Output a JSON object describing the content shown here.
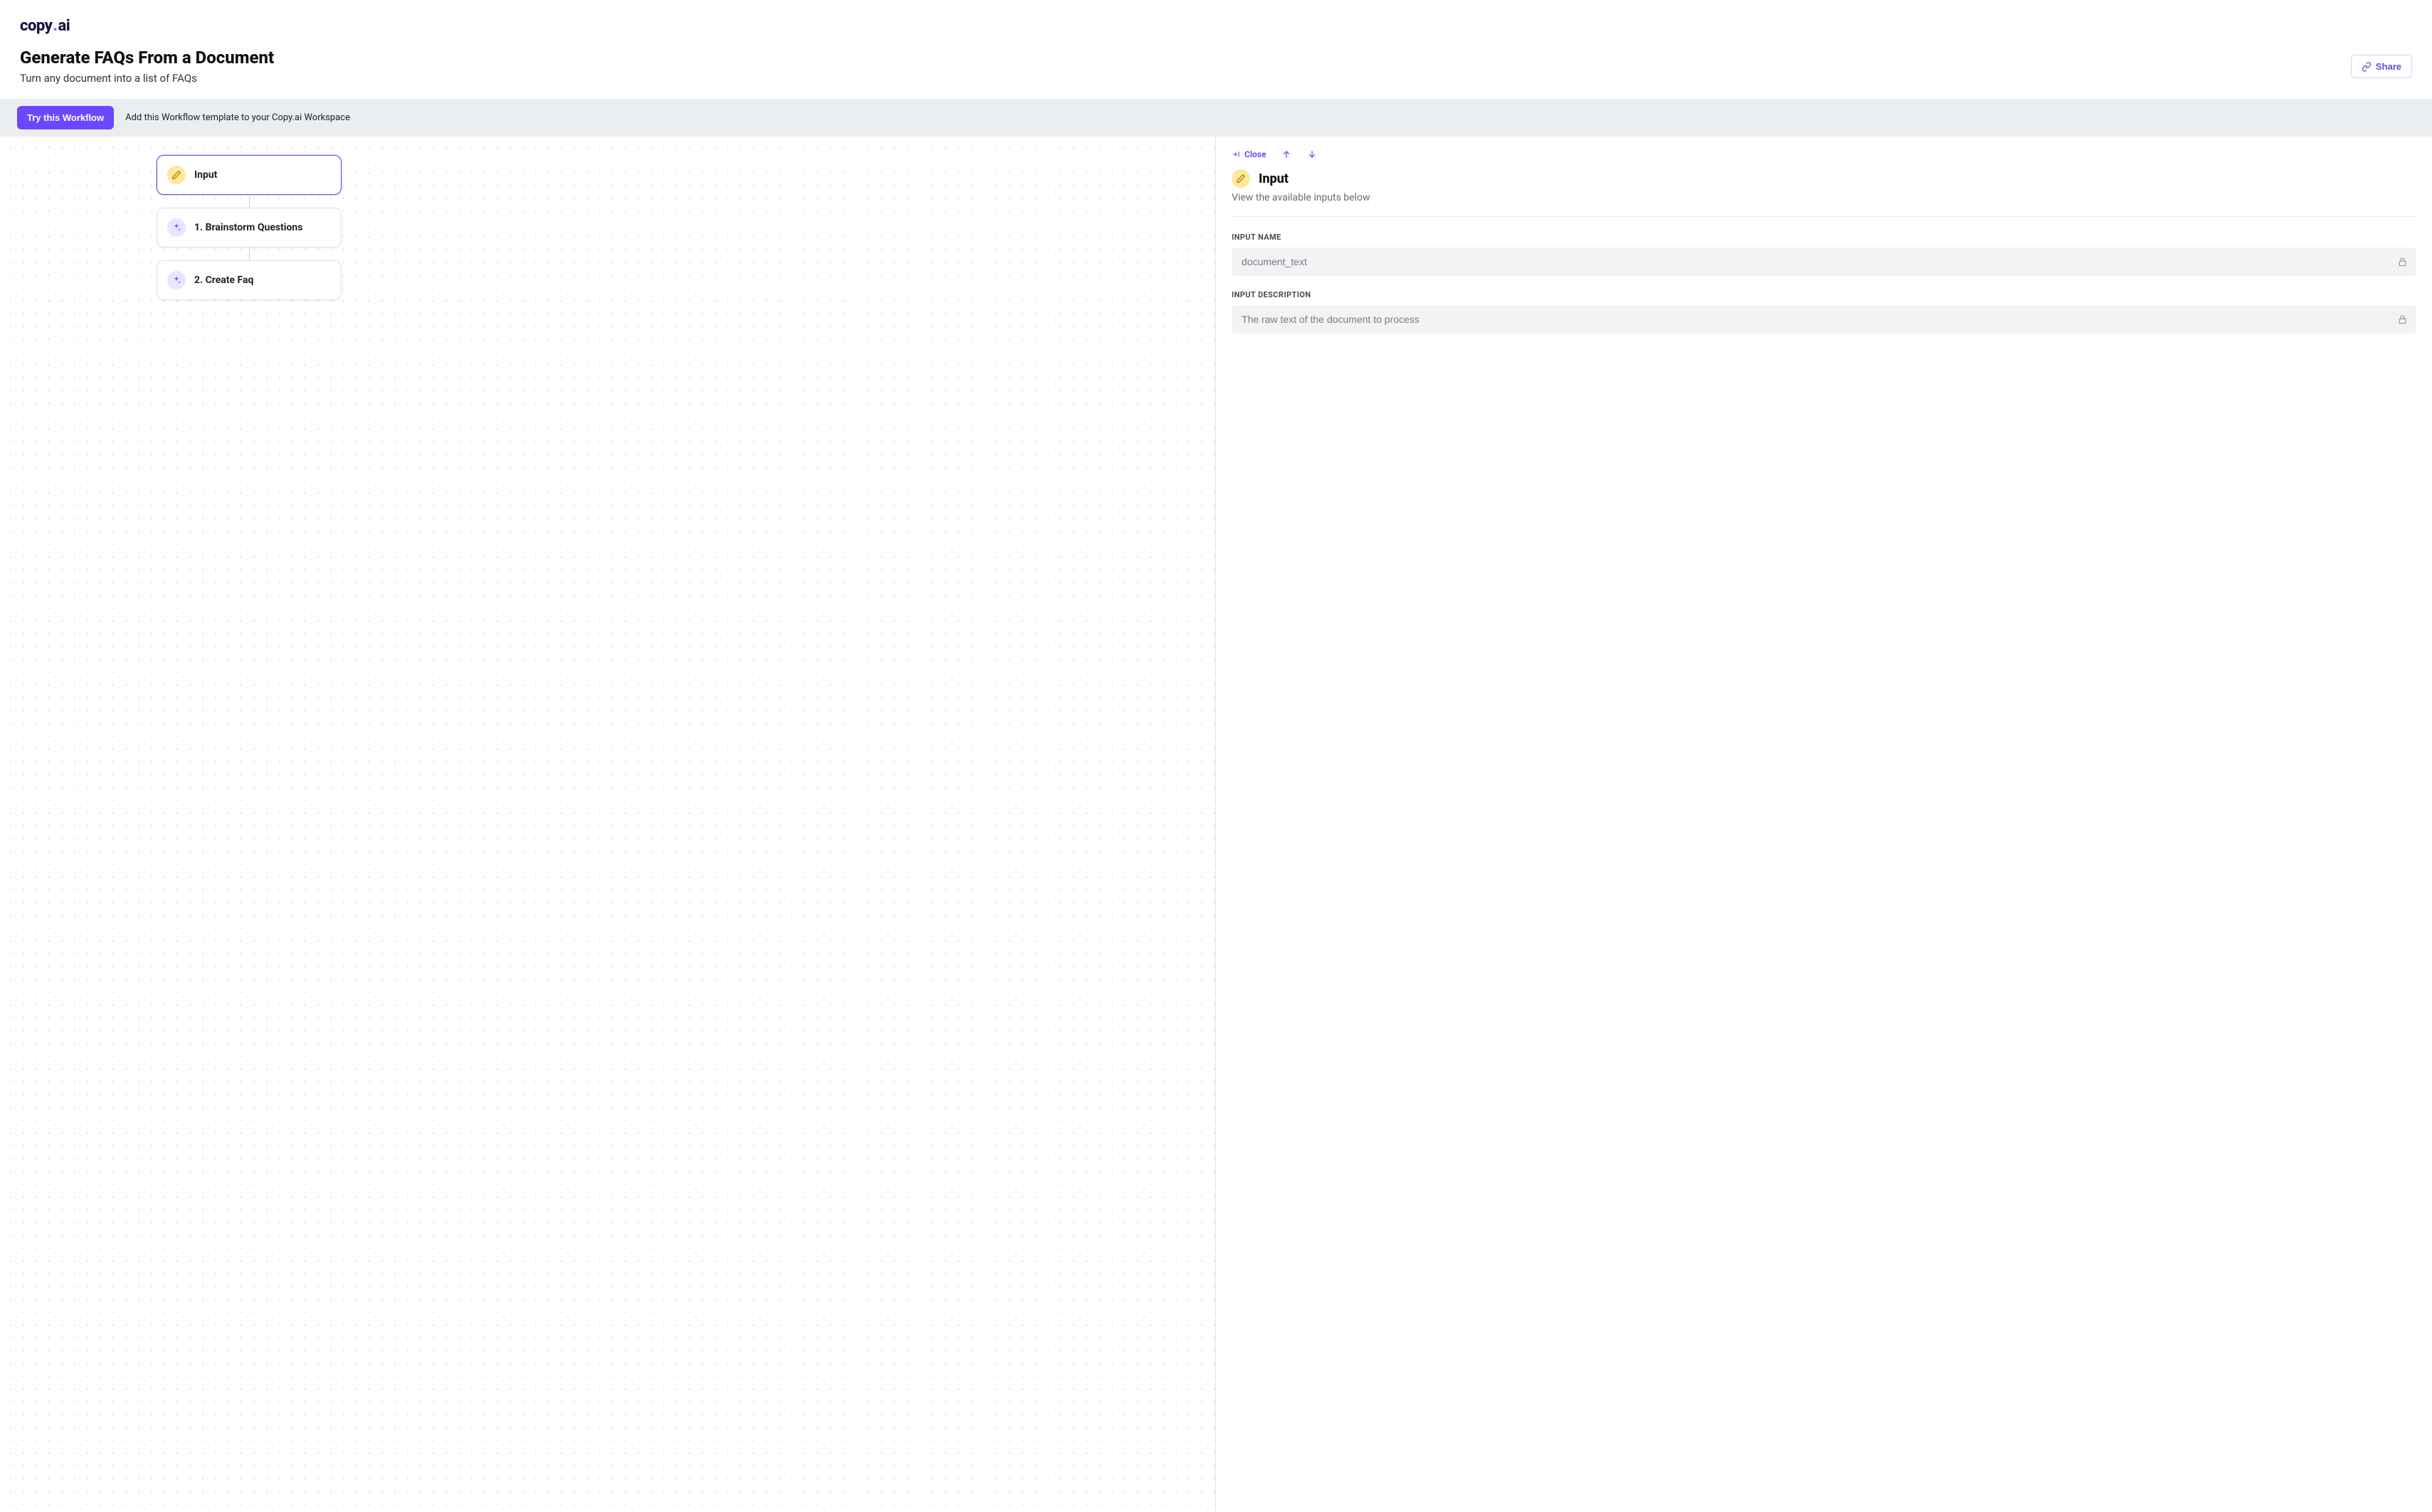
{
  "logo": {
    "part1": "copy",
    "part2": "ai"
  },
  "header": {
    "title": "Generate FAQs From a Document",
    "subtitle": "Turn any document into a list of FAQs",
    "share_label": "Share"
  },
  "banner": {
    "cta": "Try this Workflow",
    "text": "Add this Workflow template to your Copy.ai Workspace"
  },
  "nodes": [
    {
      "label": "Input",
      "icon": "pencil",
      "icon_color": "yellow",
      "selected": true
    },
    {
      "label": "1. Brainstorm Questions",
      "icon": "sparkle",
      "icon_color": "purple",
      "selected": false
    },
    {
      "label": "2. Create Faq",
      "icon": "sparkle",
      "icon_color": "purple",
      "selected": false
    }
  ],
  "panel": {
    "close_label": "Close",
    "title": "Input",
    "description": "View the available inputs below",
    "fields": [
      {
        "label": "INPUT NAME",
        "value": "document_text",
        "locked": true
      },
      {
        "label": "INPUT DESCRIPTION",
        "value": "The raw text of the document to process",
        "locked": true
      }
    ]
  }
}
